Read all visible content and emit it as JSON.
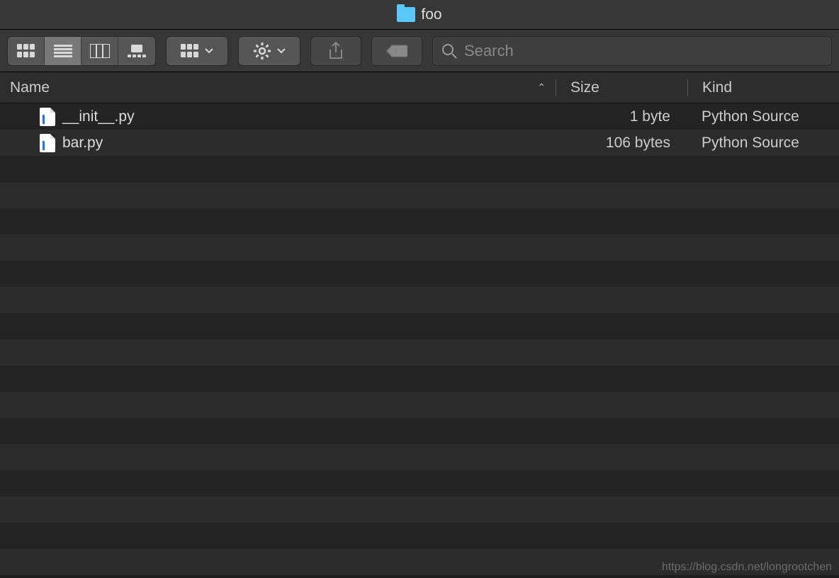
{
  "window": {
    "title": "foo"
  },
  "search": {
    "placeholder": "Search",
    "value": ""
  },
  "columns": {
    "name": "Name",
    "size": "Size",
    "kind": "Kind",
    "sort": "name_asc"
  },
  "files": [
    {
      "name": "__init__.py",
      "size": "1 byte",
      "kind": "Python Source"
    },
    {
      "name": "bar.py",
      "size": "106 bytes",
      "kind": "Python Source"
    }
  ],
  "empty_row_count": 16,
  "watermark": "https://blog.csdn.net/longrootchen",
  "icons": {
    "view_icon": "icon-grid-icon",
    "view_list": "list-icon",
    "view_col": "columns-icon",
    "view_gal": "gallery-icon",
    "group": "grid-dropdown-icon",
    "action": "gear-icon",
    "share": "share-icon",
    "tag": "tag-icon",
    "search": "search-icon",
    "sort": "chevron-up-icon"
  },
  "colors": {
    "titlebar": "#373737",
    "toolbar": "#373737",
    "row_odd": "#242424",
    "row_even": "#2c2c2c",
    "folder": "#5ac8fa"
  }
}
